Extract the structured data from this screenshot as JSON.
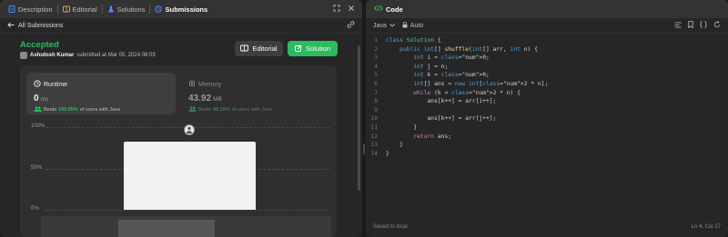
{
  "left_tabs": [
    {
      "label": "Description"
    },
    {
      "label": "Editorial"
    },
    {
      "label": "Solutions"
    },
    {
      "label": "Submissions"
    }
  ],
  "colors": {
    "accepted": "#2cbb5d",
    "tab_description": "#4a8cff",
    "tab_editorial": "#e6a23c",
    "tab_solutions": "#4a8cff",
    "tab_submissions": "#4a8cff",
    "code_tab": "#2cbb5d"
  },
  "back_label": "All Submissions",
  "submission": {
    "status": "Accepted",
    "author": "Ashutosh Kumar",
    "submitted_text": "submitted at Mar 05, 2024 08:03",
    "editorial_label": "Editorial",
    "solution_label": "Solution"
  },
  "runtime": {
    "title": "Runtime",
    "value": "0",
    "unit": "ms",
    "beats_prefix": "Beats",
    "beats_pct": "100.00%",
    "beats_suffix": "of users with Java"
  },
  "memory": {
    "title": "Memory",
    "value": "43.92",
    "unit": "MB",
    "beats_prefix": "Beats",
    "beats_pct": "98.39%",
    "beats_suffix": "of users with Java"
  },
  "chart_data": {
    "type": "bar",
    "y_ticks": [
      "100%",
      "50%",
      "0%"
    ],
    "ylim": [
      0,
      100
    ]
  },
  "editor": {
    "title": "Code",
    "language": "Java",
    "mode": "Auto",
    "status": "Saved to local",
    "cursor": "Ln 4, Col 17",
    "lines": [
      "class Solution {",
      "    public int[] shuffle(int[] arr, int n) {",
      "        int i = 0;",
      "        int j = n;",
      "        int k = 0;",
      "        int[] ans = new int[2 * n];",
      "        while (k < 2 * n) {",
      "            ans[k++] = arr[i++];",
      "",
      "            ans[k++] = arr[j++];",
      "        }",
      "        return ans;",
      "    }",
      "}"
    ]
  }
}
